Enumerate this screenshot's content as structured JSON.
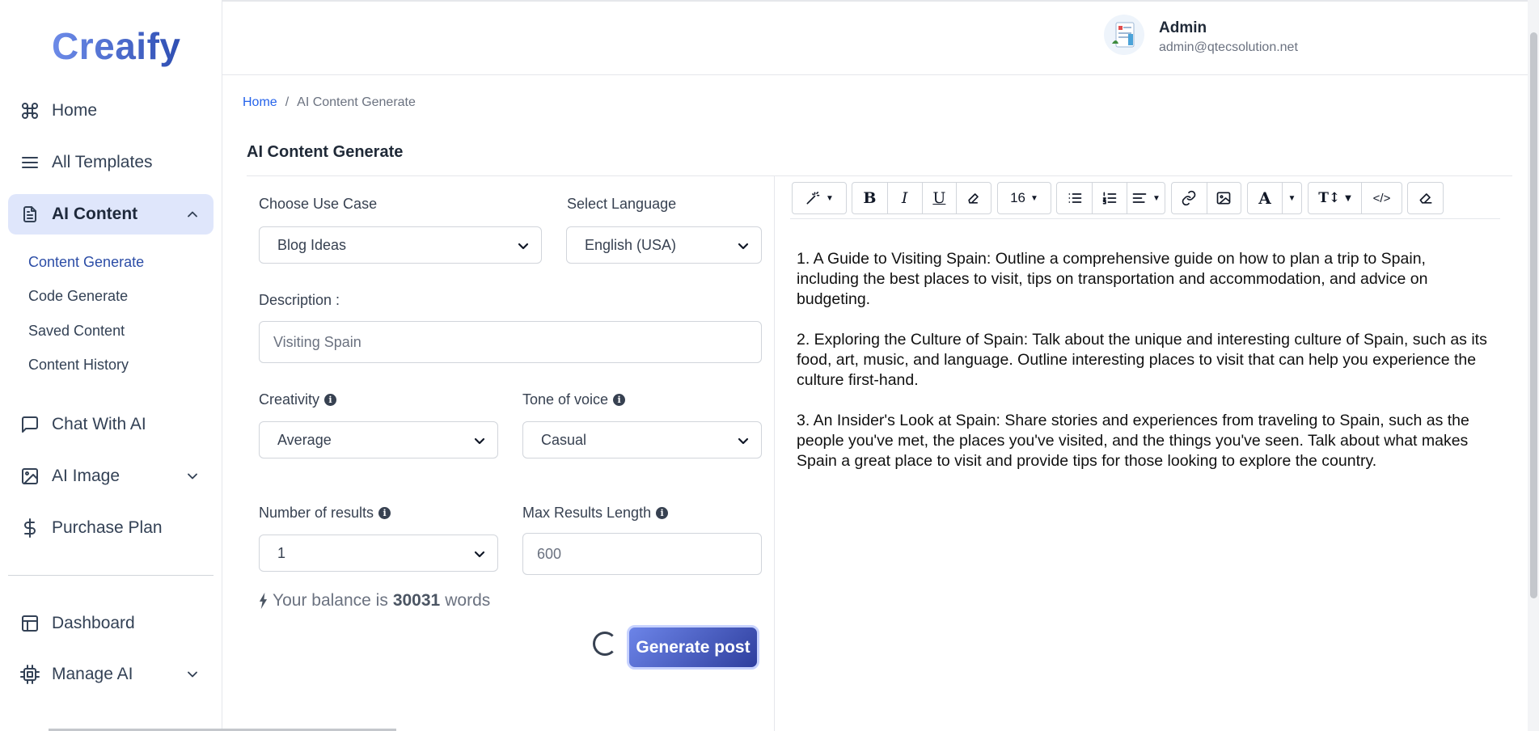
{
  "app": {
    "logo": "Creaify"
  },
  "sidebar": {
    "items": [
      {
        "label": "Home"
      },
      {
        "label": "All Templates"
      },
      {
        "label": "AI Content"
      },
      {
        "label": "Chat With AI"
      },
      {
        "label": "AI Image"
      },
      {
        "label": "Purchase Plan"
      },
      {
        "label": "Dashboard"
      },
      {
        "label": "Manage AI"
      }
    ],
    "sub_items": [
      {
        "label": "Content Generate"
      },
      {
        "label": "Code Generate"
      },
      {
        "label": "Saved Content"
      },
      {
        "label": "Content History"
      }
    ]
  },
  "header": {
    "user_name": "Admin",
    "user_email": "admin@qtecsolution.net"
  },
  "breadcrumb": {
    "home": "Home",
    "separator": "/",
    "current": "AI Content Generate"
  },
  "page": {
    "title": "AI Content Generate"
  },
  "form": {
    "use_case_label": "Choose Use Case",
    "use_case_value": "Blog Ideas",
    "language_label": "Select Language",
    "language_value": "English (USA)",
    "description_label": "Description :",
    "description_value": "Visiting Spain",
    "creativity_label": "Creativity",
    "creativity_value": "Average",
    "tone_label": "Tone of voice",
    "tone_value": "Casual",
    "results_label": "Number of results",
    "results_value": "1",
    "max_length_label": "Max Results Length",
    "max_length_placeholder": "600",
    "balance_prefix": "Your balance is",
    "balance_value": "30031",
    "balance_suffix": "words",
    "generate_label": "Generate post"
  },
  "editor": {
    "font_size": "16",
    "paragraphs": [
      "1. A Guide to Visiting Spain: Outline a comprehensive guide on how to plan a trip to Spain, including the best places to visit, tips on transportation and accommodation, and advice on budgeting.",
      "2. Exploring the Culture of Spain: Talk about the unique and interesting culture of Spain, such as its food, art, music, and language. Outline interesting places to visit that can help you experience the culture first-hand.",
      "3. An Insider's Look at Spain: Share stories and experiences from traveling to Spain, such as the people you've met, the places you've visited, and the things you've seen. Talk about what makes Spain a great place to visit and provide tips for those looking to explore the country."
    ]
  },
  "colors": {
    "accent": "#2c4da6",
    "active_bg": "#dfe6fb",
    "button_start": "#6c84e8",
    "button_end": "#2f3f9e"
  }
}
